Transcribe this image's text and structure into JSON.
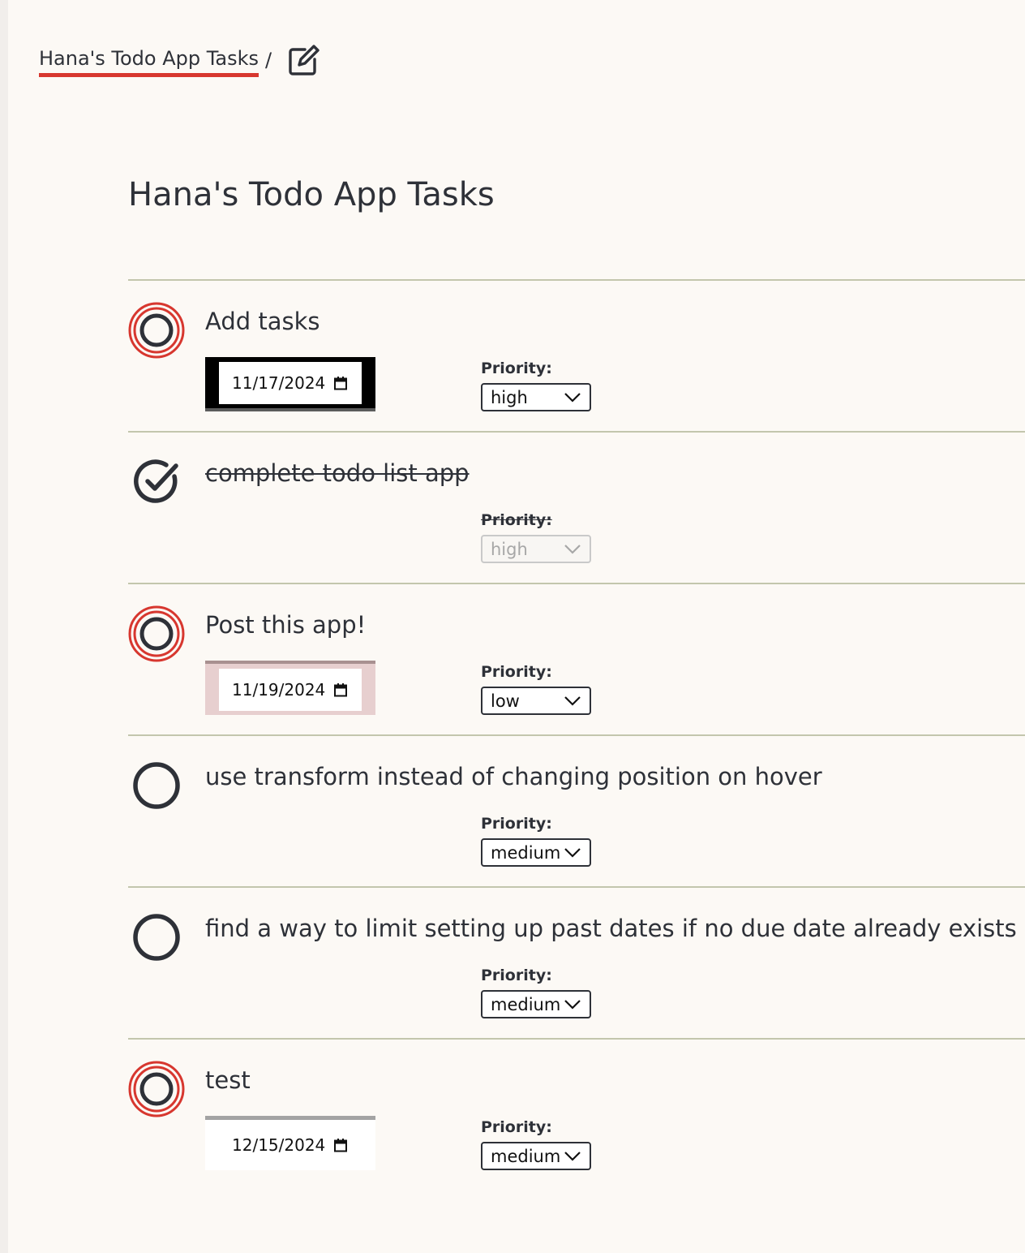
{
  "breadcrumb": {
    "link_label": "Hana's Todo App Tasks",
    "separator": "/",
    "edit_icon": "edit-pencil-square-icon"
  },
  "page_title": "Hana's Todo App Tasks",
  "colors": {
    "accent_red": "#d7372f",
    "text": "#2e3138",
    "divider": "#c3c6ad",
    "background": "#fcf9f5"
  },
  "priority_label": "Priority:",
  "tasks": [
    {
      "title": "Add tasks",
      "completed": false,
      "due_date": "11/17/2024",
      "priority": "high",
      "status_icon": "ring-red-circle-icon"
    },
    {
      "title": "complete todo list app",
      "completed": true,
      "due_date": "",
      "priority": "high",
      "status_icon": "check-circle-icon"
    },
    {
      "title": "Post this app!",
      "completed": false,
      "due_date": "11/19/2024",
      "priority": "low",
      "status_icon": "ring-red-circle-icon"
    },
    {
      "title": "use transform instead of changing position on hover",
      "completed": false,
      "due_date": "",
      "priority": "medium",
      "status_icon": "empty-circle-icon"
    },
    {
      "title": "find a way to limit setting up past dates if no due date already exists",
      "completed": false,
      "due_date": "",
      "priority": "medium",
      "status_icon": "empty-circle-icon"
    },
    {
      "title": "test",
      "completed": false,
      "due_date": "12/15/2024",
      "priority": "medium",
      "status_icon": "ring-red-circle-icon"
    }
  ]
}
